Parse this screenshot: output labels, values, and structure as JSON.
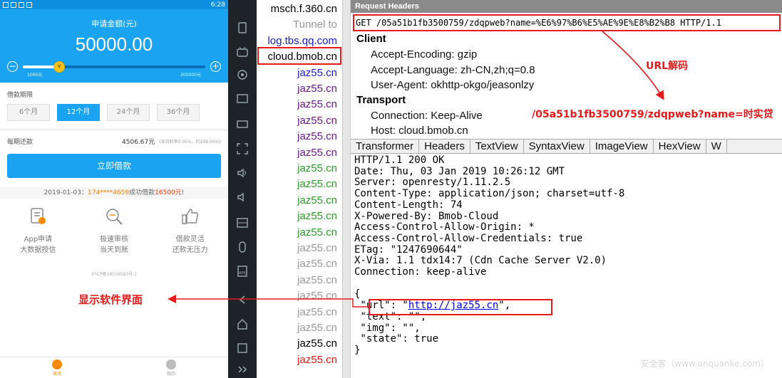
{
  "phone": {
    "status_time": "6:28",
    "amount_label": "申请金额(元)",
    "amount": "50000.00",
    "slider": {
      "min_label": "1000元",
      "max_label": "200000元",
      "knob": "¥",
      "level": 0.2
    },
    "term_label": "借款期限",
    "terms": [
      "6个月",
      "12个月",
      "24个月",
      "36个月"
    ],
    "active_term": "12个月",
    "repay_label": "每期还款",
    "repay_value": "4506.67元",
    "repay_note": "(含日利率0.05%，约249.00元)",
    "borrow_button": "立即借款",
    "ticker": {
      "date": "2019-01-03：",
      "phone": "174****4659",
      "text": "成功借款",
      "amount": "16500元",
      "end": "!"
    },
    "features": [
      {
        "line1": "App申请",
        "line2": "大数据授信",
        "icon": "app-apply-icon"
      },
      {
        "line1": "极速审核",
        "line2": "当天到账",
        "icon": "fast-review-icon"
      },
      {
        "line1": "借款灵活",
        "line2": "还款无压力",
        "icon": "thumbs-up-icon"
      }
    ],
    "license": "沪ICP备18016583号-1",
    "tabs": [
      {
        "label": "首页",
        "icon": "home-icon"
      },
      {
        "label": "我的",
        "icon": "profile-icon"
      }
    ]
  },
  "hosts": [
    {
      "text": "msch.f.360.cn",
      "color": "#000000"
    },
    {
      "text": "Tunnel to",
      "color": "#999999"
    },
    {
      "text": "log.tbs.qq.com",
      "color": "#1a1acc"
    },
    {
      "text": "cloud.bmob.cn",
      "color": "#000000"
    },
    {
      "text": "jaz55.cn",
      "color": "#1a1acc"
    },
    {
      "text": "jaz55.cn",
      "color": "#6b1a8a"
    },
    {
      "text": "jaz55.cn",
      "color": "#6b1a8a"
    },
    {
      "text": "jaz55.cn",
      "color": "#6b1a8a"
    },
    {
      "text": "jaz55.cn",
      "color": "#6b1a8a"
    },
    {
      "text": "jaz55.cn",
      "color": "#6b1a8a"
    },
    {
      "text": "jaz55.cn",
      "color": "#2e9a2e"
    },
    {
      "text": "jaz55.cn",
      "color": "#2e9a2e"
    },
    {
      "text": "jaz55.cn",
      "color": "#2e9a2e"
    },
    {
      "text": "jaz55.cn",
      "color": "#2e9a2e"
    },
    {
      "text": "jaz55.cn",
      "color": "#2e9a2e"
    },
    {
      "text": "jaz55.cn",
      "color": "#999999"
    },
    {
      "text": "jaz55.cn",
      "color": "#999999"
    },
    {
      "text": "jaz55.cn",
      "color": "#999999"
    },
    {
      "text": "jaz55.cn",
      "color": "#999999"
    },
    {
      "text": "jaz55.cn",
      "color": "#999999"
    },
    {
      "text": "jaz55.cn",
      "color": "#999999"
    },
    {
      "text": "jaz55.cn",
      "color": "#000000"
    },
    {
      "text": "jaz55.cn",
      "color": "#e51a1a"
    }
  ],
  "request": {
    "title": "Request Headers",
    "line": "GET /05a51b1fb3500759/zdqpweb?name=%E6%97%B6%E5%AE%9E%E8%B2%B8 HTTP/1.1",
    "client_label": "Client",
    "client_headers": [
      "Accept-Encoding: gzip",
      "Accept-Language: zh-CN,zh;q=0.8",
      "User-Agent: okhttp-okgo/jeasonlzy"
    ],
    "transport_label": "Transport",
    "transport_headers": [
      "Connection: Keep-Alive",
      "Host: cloud.bmob.cn"
    ]
  },
  "response_tabs": [
    "Transformer",
    "Headers",
    "TextView",
    "SyntaxView",
    "ImageView",
    "HexView",
    "W"
  ],
  "response": {
    "headers": [
      "HTTP/1.1 200 OK",
      "Date: Thu, 03 Jan 2019 10:26:12 GMT",
      "Server: openresty/1.11.2.5",
      "Content-Type: application/json; charset=utf-8",
      "Content-Length: 74",
      "X-Powered-By: Bmob-Cloud",
      "Access-Control-Allow-Origin: *",
      "Access-Control-Allow-Credentials: true",
      "ETag: \"1247690644\"",
      "X-Via: 1.1 tdx14:7 (Cdn Cache Server V2.0)",
      "Connection: keep-alive"
    ],
    "body_open": "{",
    "url_key": " \"url\": \"",
    "url_value": "http://jaz55.cn",
    "url_end": "\",",
    "body_lines": [
      " \"text\": \"\",",
      " \"img\": \"\",",
      " \"state\": true",
      "}"
    ]
  },
  "annotations": {
    "url_decode": "URL解码",
    "decoded_path": "/05a51b1fb3500759/zdqpweb?name=时实贷",
    "show_ui": "显示软件界面",
    "watermark": "安全客（www.anquanke.com）"
  }
}
